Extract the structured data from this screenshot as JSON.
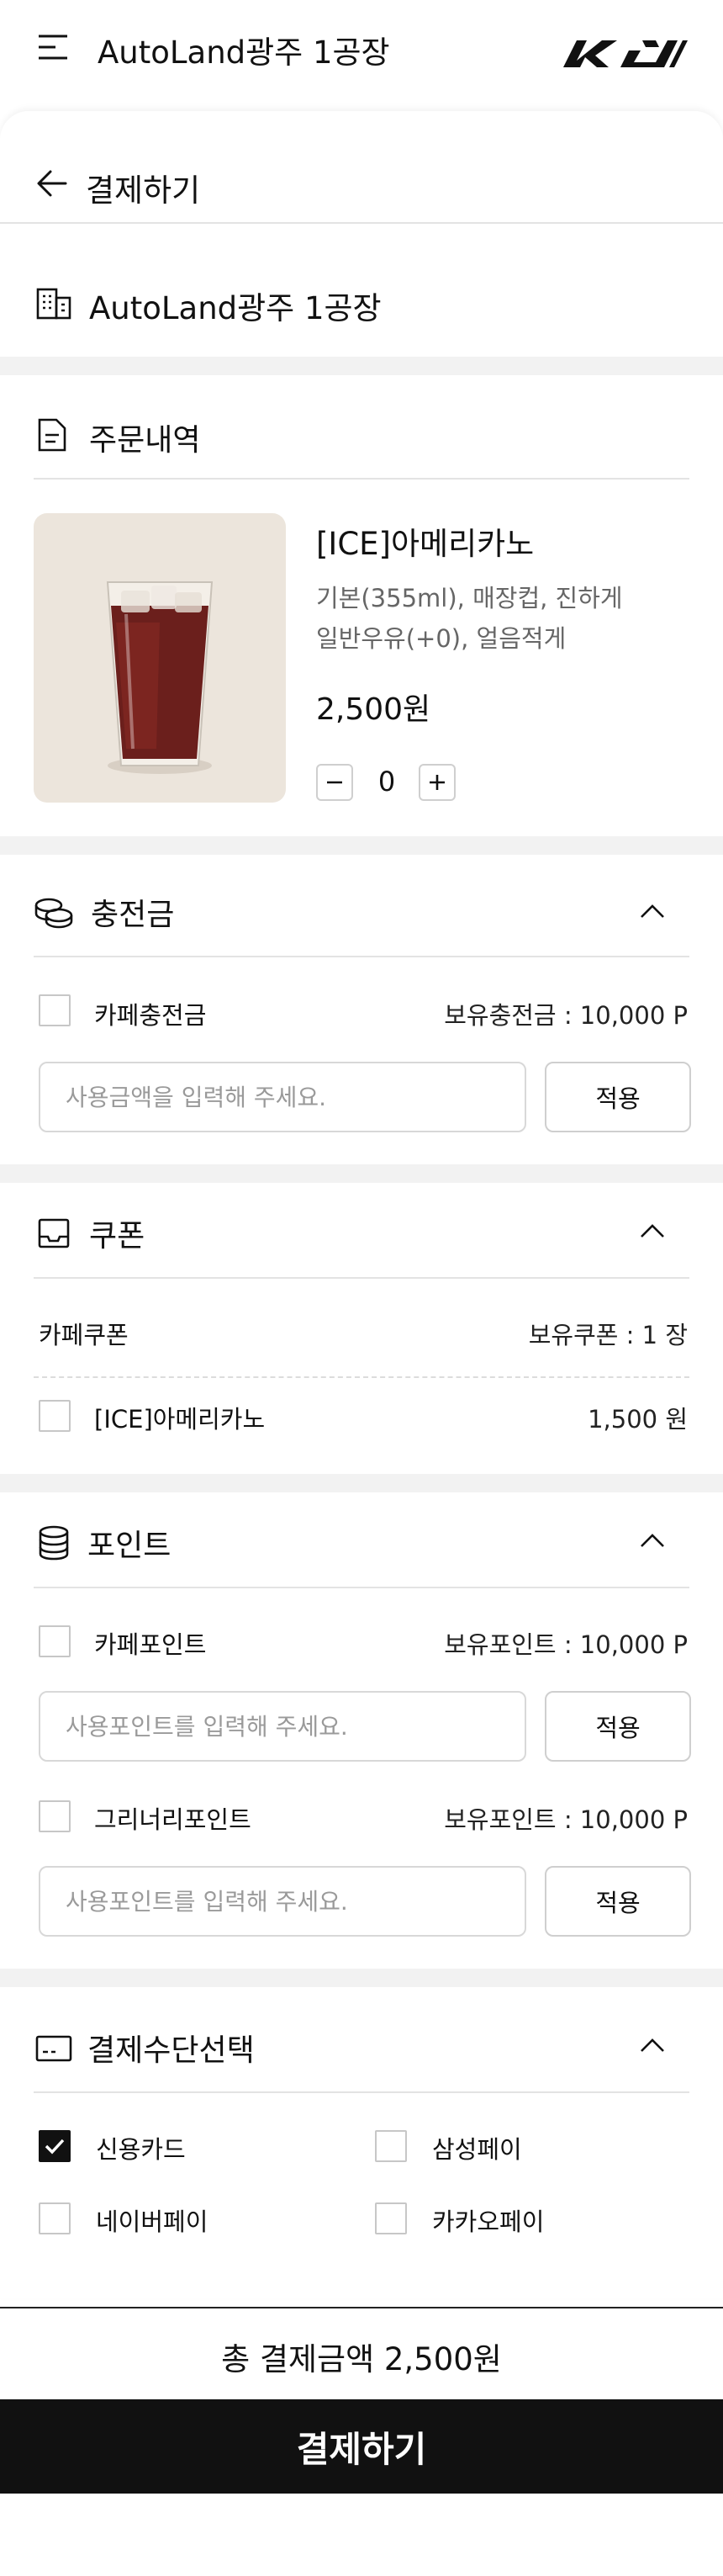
{
  "header": {
    "store_name": "AutoLand광주 1공장",
    "brand": "KIA"
  },
  "page": {
    "title": "결제하기"
  },
  "store": {
    "name": "AutoLand광주 1공장"
  },
  "order": {
    "section_title": "주문내역",
    "item": {
      "name": "[ICE]아메리카노",
      "options_line1": "기본(355ml), 매장컵, 진하게",
      "options_line2": "일반우유(+0), 얼음적게",
      "price": "2,500원",
      "quantity": "0"
    }
  },
  "charge": {
    "section_title": "충전금",
    "option_label": "카페충전금",
    "balance": "보유충전금 : 10,000 P",
    "input_placeholder": "사용금액을 입력해 주세요.",
    "apply_label": "적용"
  },
  "coupon": {
    "section_title": "쿠폰",
    "category": "카페쿠폰",
    "count": "보유쿠폰 : 1 장",
    "item_label": "[ICE]아메리카노",
    "item_value": "1,500 원"
  },
  "points": {
    "section_title": "포인트",
    "cafe": {
      "label": "카페포인트",
      "balance": "보유포인트 : 10,000 P",
      "input_placeholder": "사용포인트를 입력해 주세요.",
      "apply_label": "적용"
    },
    "greenery": {
      "label": "그리너리포인트",
      "balance": "보유포인트 : 10,000 P",
      "input_placeholder": "사용포인트를 입력해 주세요.",
      "apply_label": "적용"
    }
  },
  "payment": {
    "section_title": "결제수단선택",
    "methods": [
      {
        "label": "신용카드",
        "checked": true
      },
      {
        "label": "삼성페이",
        "checked": false
      },
      {
        "label": "네이버페이",
        "checked": false
      },
      {
        "label": "카카오페이",
        "checked": false
      }
    ]
  },
  "footer": {
    "total": "총 결제금액 2,500원",
    "pay_button": "결제하기"
  },
  "colors": {
    "primary": "#111111",
    "band": "#f2f2f2",
    "divider": "#e3e3e3",
    "product_bg": "#ece5dc"
  }
}
